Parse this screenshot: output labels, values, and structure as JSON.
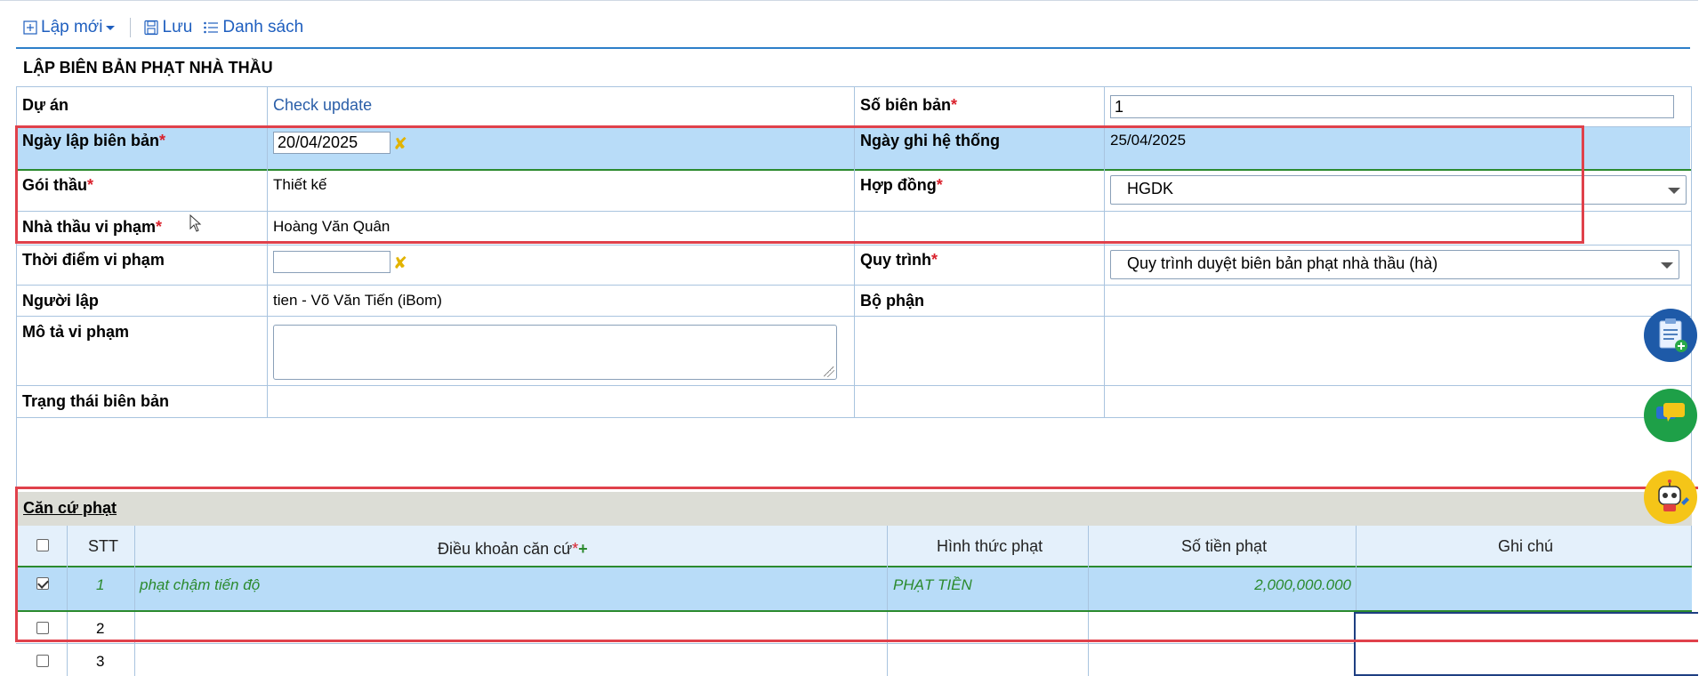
{
  "toolbar": {
    "new_label": "Lập mới",
    "save_label": "Lưu",
    "list_label": "Danh sách"
  },
  "form": {
    "title": "LẬP BIÊN BẢN PHẠT NHÀ THẦU",
    "du_an_label": "Dự án",
    "du_an_value": "Check update",
    "so_bien_ban_label": "Số biên bản",
    "so_bien_ban_value": "1",
    "ngay_lap_label": "Ngày lập biên bản",
    "ngay_lap_value": "20/04/2025",
    "ngay_ghi_label": "Ngày ghi hệ thống",
    "ngay_ghi_value": "25/04/2025",
    "goi_thau_label": "Gói thầu",
    "goi_thau_value": "Thiết kế",
    "hop_dong_label": "Hợp đồng",
    "hop_dong_value": "HGDK",
    "nha_thau_label": "Nhà thầu vi phạm",
    "nha_thau_value": "Hoàng Văn Quân",
    "thoi_diem_label": "Thời điểm vi phạm",
    "thoi_diem_value": "",
    "quy_trinh_label": "Quy trình",
    "quy_trinh_value": "Quy trình duyệt biên bản phạt nhà thầu (hà)",
    "nguoi_lap_label": "Người lập",
    "nguoi_lap_value": "tien - Võ Văn Tiến (iBom)",
    "bo_phan_label": "Bộ phận",
    "mo_ta_label": "Mô tả vi phạm",
    "trang_thai_label": "Trạng thái biên bản",
    "required_mark": "*"
  },
  "can_cu": {
    "title": "Căn cứ phạt",
    "headers": {
      "stt": "STT",
      "dieu_khoan": "Điều khoản căn cứ",
      "hinh_thuc": "Hình thức phạt",
      "so_tien": "Số tiền phạt",
      "ghi_chu": "Ghi chú"
    },
    "add_mark": "+",
    "rows": [
      {
        "stt": "1",
        "dieu_khoan": "phạt chậm tiến độ",
        "hinh_thuc": "PHẠT TIỀN",
        "so_tien": "2,000,000.000",
        "ghi_chu": "",
        "checked": true
      },
      {
        "stt": "2",
        "dieu_khoan": "",
        "hinh_thuc": "",
        "so_tien": "",
        "ghi_chu": "",
        "checked": false
      },
      {
        "stt": "3",
        "dieu_khoan": "",
        "hinh_thuc": "",
        "so_tien": "",
        "ghi_chu": "",
        "checked": false
      }
    ]
  },
  "colors": {
    "accent": "#2d7fc9",
    "highlight_row": "#b8dcf8",
    "annotation_red": "#e0414b",
    "row_text_green": "#2b8a2e"
  }
}
